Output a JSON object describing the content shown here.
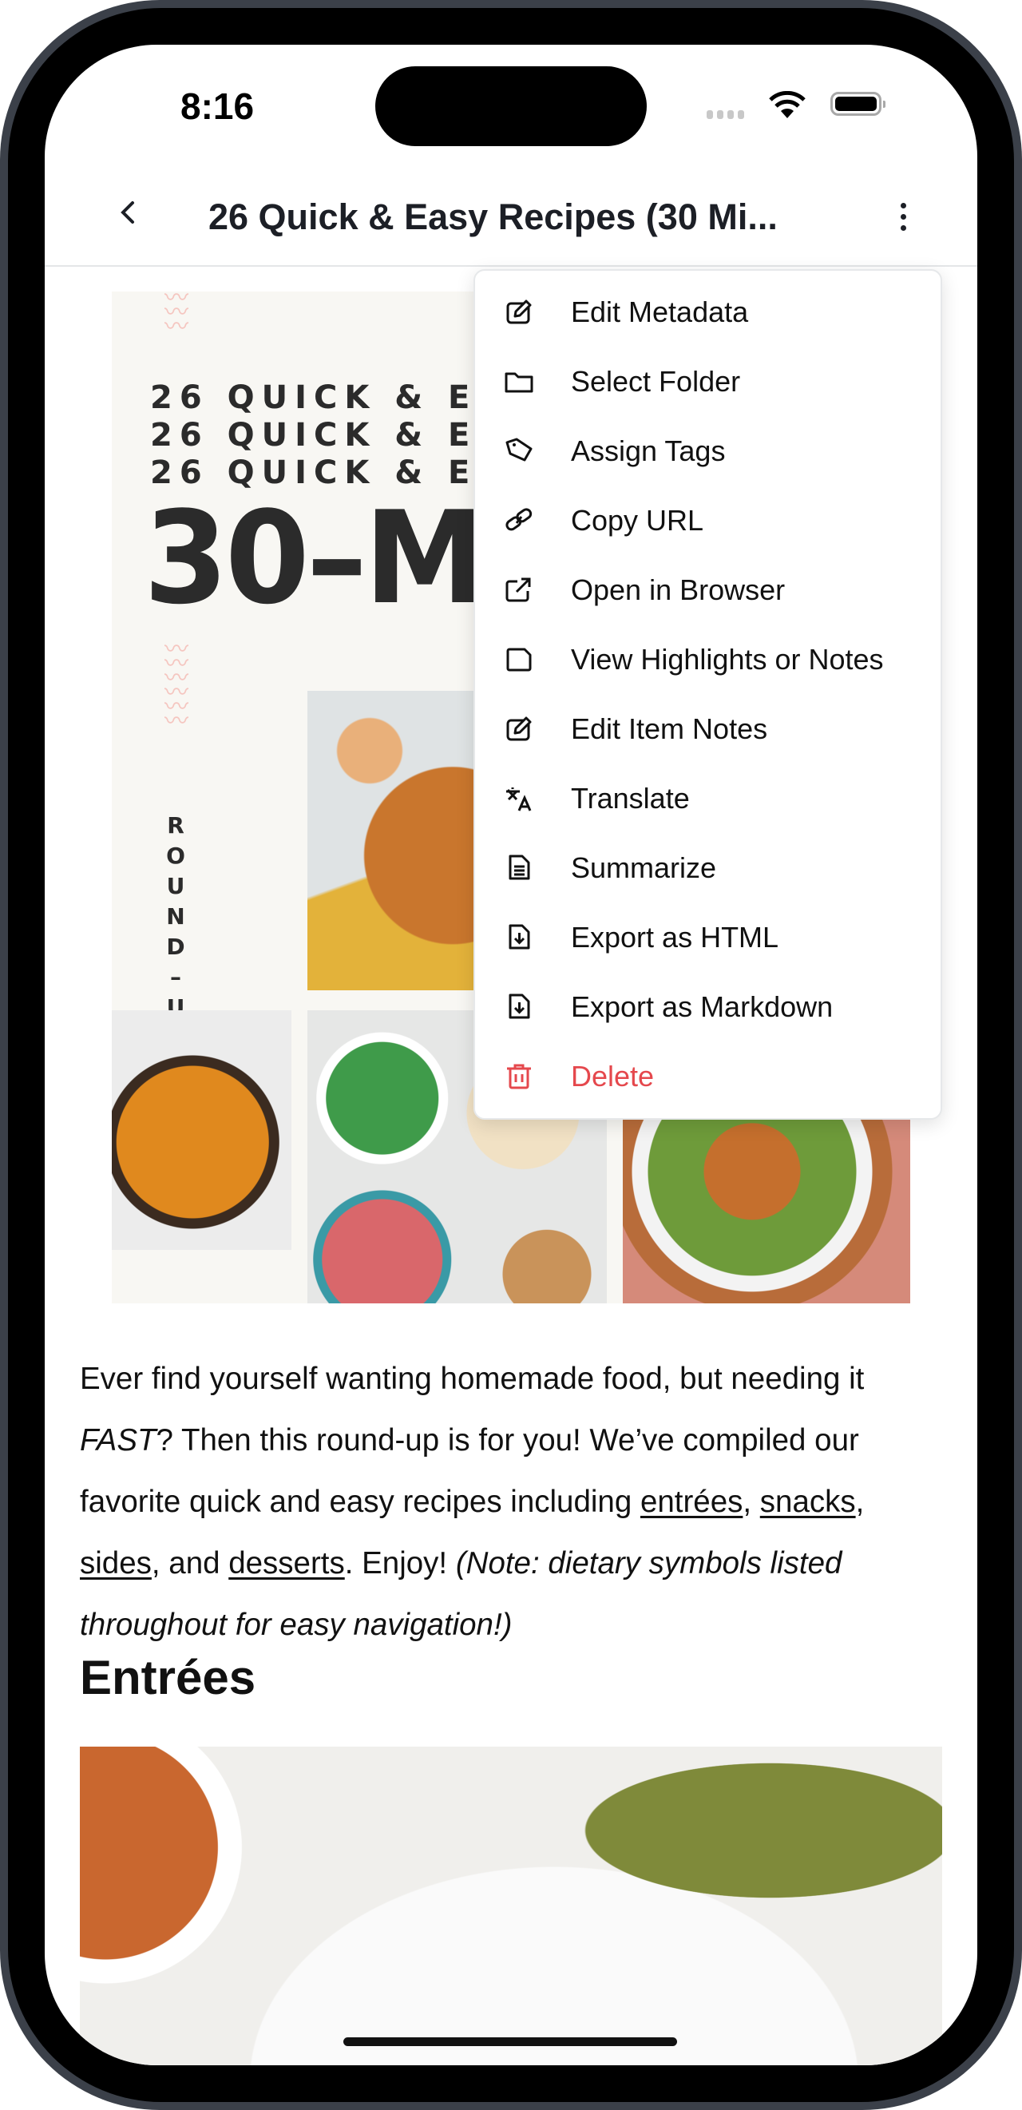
{
  "status_bar": {
    "time": "8:16",
    "icons": [
      "signal-icon",
      "wifi-icon",
      "battery-icon"
    ]
  },
  "nav": {
    "title": "26 Quick & Easy Recipes (30 Mi...",
    "back_icon": "chevron-left-icon",
    "menu_icon": "more-vertical-icon"
  },
  "hero_image": {
    "line1": "26 QUICK & EASY",
    "line2": "26 QUICK & EASY",
    "line3": "26 QUICK & EASY",
    "big": "30–MIN",
    "side": "ROUND–UP"
  },
  "article": {
    "p1": "Ever find yourself wanting homemade food, but needing it ",
    "p_fast": "FAST",
    "p2": "? Then this round-up is for you! We’ve compiled our favorite quick and easy recipes including ",
    "link_entrees": "entrées",
    "sep1": ", ",
    "link_snacks": "snacks",
    "sep2": ", ",
    "link_sides": "sides",
    "sep3": ", and ",
    "link_desserts": "desserts",
    "p3": ". Enjoy! ",
    "note": "(Note: dietary symbols listed throughout for easy navigation!)",
    "heading": "Entrées"
  },
  "menu": {
    "items": [
      {
        "label": "Edit Metadata",
        "icon": "edit-icon"
      },
      {
        "label": "Select Folder",
        "icon": "folder-icon"
      },
      {
        "label": "Assign Tags",
        "icon": "tag-icon"
      },
      {
        "label": "Copy URL",
        "icon": "link-icon"
      },
      {
        "label": "Open in Browser",
        "icon": "external-link-icon"
      },
      {
        "label": "View Highlights or Notes",
        "icon": "note-icon"
      },
      {
        "label": "Edit Item Notes",
        "icon": "edit-icon"
      },
      {
        "label": "Translate",
        "icon": "translate-icon"
      },
      {
        "label": "Summarize",
        "icon": "file-text-icon"
      },
      {
        "label": "Export as HTML",
        "icon": "file-download-icon"
      },
      {
        "label": "Export as Markdown",
        "icon": "file-download-icon"
      },
      {
        "label": "Delete",
        "icon": "trash-icon"
      }
    ]
  },
  "colors": {
    "danger": "#e5484d",
    "text": "#111111",
    "bezel": "#3b4049"
  }
}
